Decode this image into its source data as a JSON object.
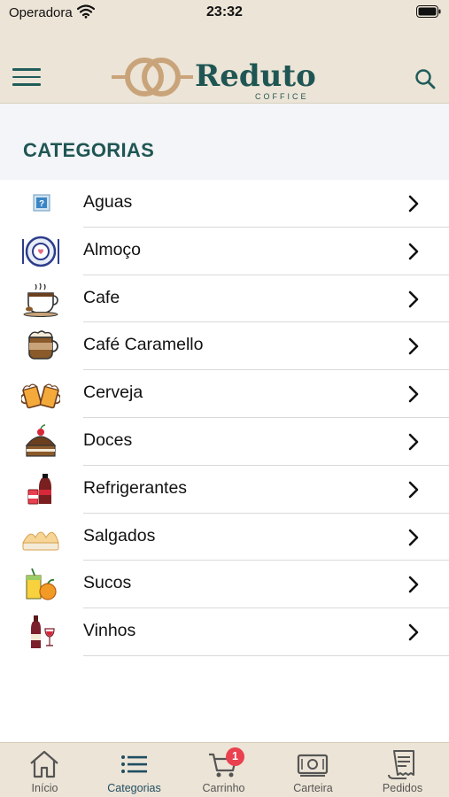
{
  "status_bar": {
    "carrier": "Operadora",
    "time": "23:32"
  },
  "header": {
    "logo_text": "Reduto",
    "logo_subtext": "COFFICE"
  },
  "section_title": "CATEGORIAS",
  "categories": [
    {
      "label": "Aguas",
      "icon": "water-placeholder-icon"
    },
    {
      "label": "Almoço",
      "icon": "plate-icon"
    },
    {
      "label": "Cafe",
      "icon": "coffee-cup-icon"
    },
    {
      "label": "Café Caramello",
      "icon": "caramel-coffee-icon"
    },
    {
      "label": "Cerveja",
      "icon": "beer-mugs-icon"
    },
    {
      "label": "Doces",
      "icon": "cake-icon"
    },
    {
      "label": "Refrigerantes",
      "icon": "soda-icon"
    },
    {
      "label": "Salgados",
      "icon": "pastries-icon"
    },
    {
      "label": "Sucos",
      "icon": "juice-icon"
    },
    {
      "label": "Vinhos",
      "icon": "wine-icon"
    }
  ],
  "tabs": [
    {
      "label": "Início",
      "icon": "home-icon"
    },
    {
      "label": "Categorias",
      "icon": "list-icon",
      "active": true
    },
    {
      "label": "Carrinho",
      "icon": "cart-icon",
      "badge": "1"
    },
    {
      "label": "Carteira",
      "icon": "wallet-icon"
    },
    {
      "label": "Pedidos",
      "icon": "receipt-icon"
    }
  ],
  "colors": {
    "accent": "#1f5654",
    "header_bg": "#ece4d6",
    "badge": "#e9414f",
    "logo_ring": "#c9a47a"
  }
}
